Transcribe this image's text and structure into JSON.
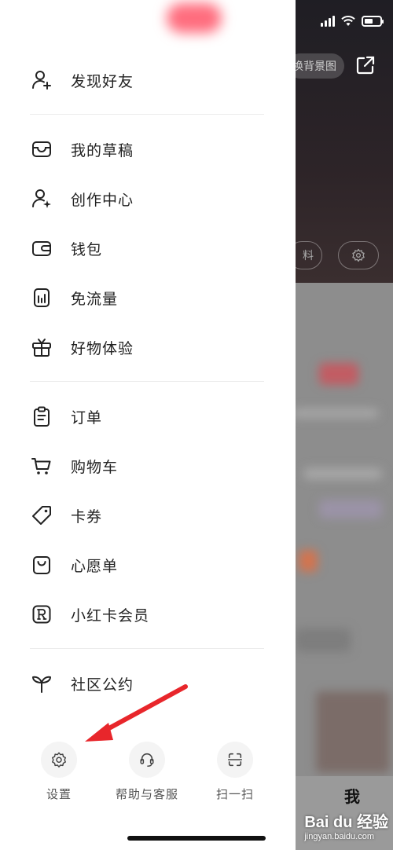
{
  "drawer": {
    "menu": {
      "find_friends": "发现好友",
      "drafts": "我的草稿",
      "creator_center": "创作中心",
      "wallet": "钱包",
      "free_data": "免流量",
      "product_trial": "好物体验",
      "orders": "订单",
      "cart": "购物车",
      "coupons": "卡券",
      "wishlist": "心愿单",
      "red_card_member": "小红卡会员",
      "community_rules": "社区公约"
    },
    "bottom": {
      "settings": "设置",
      "help_support": "帮助与客服",
      "scan": "扫一扫"
    }
  },
  "background_app": {
    "change_background_pill": "换背景图",
    "edit_pill": "料",
    "me_tab": "我"
  },
  "watermark": {
    "brand": "Bai du 经验",
    "url": "jingyan.baidu.com"
  },
  "colors": {
    "annotation_arrow": "#e8262b",
    "drawer_bg": "#ffffff",
    "divider": "#ececec"
  }
}
